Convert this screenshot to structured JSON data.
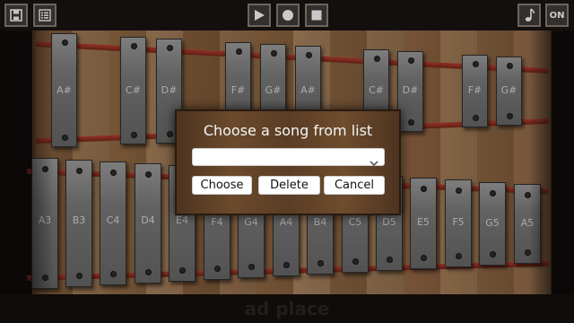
{
  "toolbar": {
    "left_buttons": [
      {
        "name": "save-button",
        "icon": "floppy-disk-icon"
      },
      {
        "name": "song-list-button",
        "icon": "list-icon"
      }
    ],
    "center_buttons": [
      {
        "name": "play-button",
        "icon": "play-icon"
      },
      {
        "name": "record-button",
        "icon": "record-icon"
      },
      {
        "name": "stop-button",
        "icon": "stop-icon"
      }
    ],
    "right_buttons": [
      {
        "name": "music-note-button",
        "icon": "music-note-icon"
      },
      {
        "name": "sound-toggle-button",
        "label": "ON"
      }
    ]
  },
  "keys": {
    "upper_row": [
      "A#",
      "C#",
      "D#",
      "F#",
      "G#",
      "A#",
      "C#",
      "D#",
      "F#",
      "G#"
    ],
    "lower_row": [
      "A3",
      "B3",
      "C4",
      "D4",
      "E4",
      "F4",
      "G4",
      "A4",
      "B4",
      "C5",
      "D5",
      "E5",
      "F5",
      "G5",
      "A5"
    ]
  },
  "dialog": {
    "title": "Choose a song from list",
    "select_value": "",
    "buttons": {
      "choose": "Choose",
      "delete": "Delete",
      "cancel": "Cancel"
    }
  },
  "ad": {
    "text": "ad place"
  },
  "colors": {
    "rail": "#8c2f22",
    "key_metal": "#7a7a7a",
    "wood": "#8a6444",
    "dialog_wood": "#5e4027"
  }
}
